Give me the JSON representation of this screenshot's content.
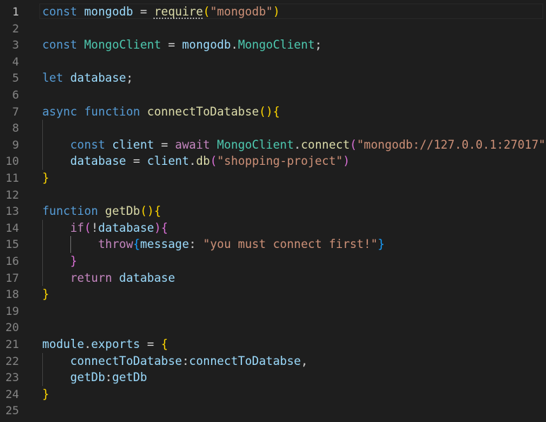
{
  "editor": {
    "language": "javascript",
    "theme": "dark",
    "active_line": 1,
    "lines": [
      {
        "n": "1",
        "tokens": [
          [
            "kw",
            "const"
          ],
          [
            "op",
            " "
          ],
          [
            "var",
            "mongodb"
          ],
          [
            "op",
            " = "
          ],
          [
            "fn",
            "require"
          ],
          [
            "b1",
            "("
          ],
          [
            "str",
            "\"mongodb\""
          ],
          [
            "b1",
            ")"
          ]
        ]
      },
      {
        "n": "2",
        "tokens": []
      },
      {
        "n": "3",
        "tokens": [
          [
            "kw",
            "const"
          ],
          [
            "op",
            " "
          ],
          [
            "cls",
            "MongoClient"
          ],
          [
            "op",
            " = "
          ],
          [
            "var",
            "mongodb"
          ],
          [
            "op",
            "."
          ],
          [
            "cls",
            "MongoClient"
          ],
          [
            "op",
            ";"
          ]
        ]
      },
      {
        "n": "4",
        "tokens": []
      },
      {
        "n": "5",
        "tokens": [
          [
            "kw",
            "let"
          ],
          [
            "op",
            " "
          ],
          [
            "var",
            "database"
          ],
          [
            "op",
            ";"
          ]
        ]
      },
      {
        "n": "6",
        "tokens": []
      },
      {
        "n": "7",
        "tokens": [
          [
            "kw",
            "async"
          ],
          [
            "op",
            " "
          ],
          [
            "kw",
            "function"
          ],
          [
            "op",
            " "
          ],
          [
            "fn",
            "connectToDatabse"
          ],
          [
            "b1",
            "()"
          ],
          [
            "b1",
            "{"
          ]
        ]
      },
      {
        "n": "8",
        "tokens": []
      },
      {
        "n": "9",
        "tokens": [
          [
            "op",
            "    "
          ],
          [
            "kw",
            "const"
          ],
          [
            "op",
            " "
          ],
          [
            "var",
            "client"
          ],
          [
            "op",
            " = "
          ],
          [
            "ctl",
            "await"
          ],
          [
            "op",
            " "
          ],
          [
            "cls",
            "MongoClient"
          ],
          [
            "op",
            "."
          ],
          [
            "fn",
            "connect"
          ],
          [
            "b2",
            "("
          ],
          [
            "str",
            "\"mongodb://127.0.0.1:27017\""
          ],
          [
            "b2",
            ")"
          ]
        ]
      },
      {
        "n": "10",
        "tokens": [
          [
            "op",
            "    "
          ],
          [
            "var",
            "database"
          ],
          [
            "op",
            " = "
          ],
          [
            "var",
            "client"
          ],
          [
            "op",
            "."
          ],
          [
            "fn",
            "db"
          ],
          [
            "b2",
            "("
          ],
          [
            "str",
            "\"shopping-project\""
          ],
          [
            "b2",
            ")"
          ]
        ]
      },
      {
        "n": "11",
        "tokens": [
          [
            "b1",
            "}"
          ]
        ]
      },
      {
        "n": "12",
        "tokens": []
      },
      {
        "n": "13",
        "tokens": [
          [
            "kw",
            "function"
          ],
          [
            "op",
            " "
          ],
          [
            "fn",
            "getDb"
          ],
          [
            "b1",
            "()"
          ],
          [
            "b1",
            "{"
          ]
        ]
      },
      {
        "n": "14",
        "tokens": [
          [
            "op",
            "    "
          ],
          [
            "ctl",
            "if"
          ],
          [
            "b2",
            "("
          ],
          [
            "op",
            "!"
          ],
          [
            "var",
            "database"
          ],
          [
            "b2",
            ")"
          ],
          [
            "b2",
            "{"
          ]
        ]
      },
      {
        "n": "15",
        "tokens": [
          [
            "op",
            "        "
          ],
          [
            "ctl",
            "throw"
          ],
          [
            "b3",
            "{"
          ],
          [
            "var",
            "message"
          ],
          [
            "op",
            ": "
          ],
          [
            "str",
            "\"you must connect first!\""
          ],
          [
            "b3",
            "}"
          ]
        ]
      },
      {
        "n": "16",
        "tokens": [
          [
            "op",
            "    "
          ],
          [
            "b2",
            "}"
          ]
        ]
      },
      {
        "n": "17",
        "tokens": [
          [
            "op",
            "    "
          ],
          [
            "ctl",
            "return"
          ],
          [
            "op",
            " "
          ],
          [
            "var",
            "database"
          ]
        ]
      },
      {
        "n": "18",
        "tokens": [
          [
            "b1",
            "}"
          ]
        ]
      },
      {
        "n": "19",
        "tokens": []
      },
      {
        "n": "20",
        "tokens": []
      },
      {
        "n": "21",
        "tokens": [
          [
            "var",
            "module"
          ],
          [
            "op",
            "."
          ],
          [
            "var",
            "exports"
          ],
          [
            "op",
            " = "
          ],
          [
            "b1",
            "{"
          ]
        ]
      },
      {
        "n": "22",
        "tokens": [
          [
            "op",
            "    "
          ],
          [
            "var",
            "connectToDatabse"
          ],
          [
            "op",
            ":"
          ],
          [
            "var",
            "connectToDatabse"
          ],
          [
            "op",
            ","
          ]
        ]
      },
      {
        "n": "23",
        "tokens": [
          [
            "op",
            "    "
          ],
          [
            "var",
            "getDb"
          ],
          [
            "op",
            ":"
          ],
          [
            "var",
            "getDb"
          ]
        ]
      },
      {
        "n": "24",
        "tokens": [
          [
            "b1",
            "}"
          ]
        ]
      },
      {
        "n": "25",
        "tokens": []
      }
    ]
  }
}
